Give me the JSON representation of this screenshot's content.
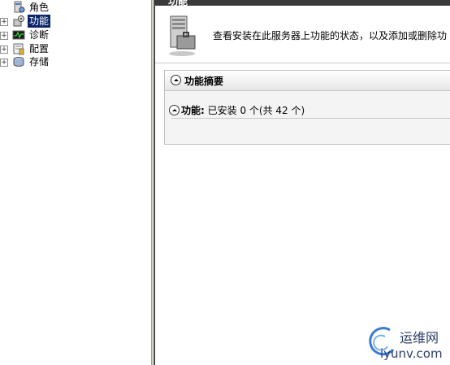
{
  "tree": {
    "items": [
      {
        "label": "角色",
        "expander": "",
        "icon": "roles-icon"
      },
      {
        "label": "功能",
        "expander": "+",
        "icon": "features-icon",
        "selected": true
      },
      {
        "label": "诊断",
        "expander": "+",
        "icon": "diagnostics-icon"
      },
      {
        "label": "配置",
        "expander": "+",
        "icon": "configuration-icon"
      },
      {
        "label": "存储",
        "expander": "+",
        "icon": "storage-icon"
      }
    ]
  },
  "content": {
    "title": "功能",
    "description": "查看安装在此服务器上功能的状态，以及添加或删除功",
    "panel": {
      "title": "功能摘要",
      "summary_label": "功能:",
      "summary_value": " 已安装 0 个(共 42 个)"
    }
  },
  "watermark": {
    "chinese": "运维网",
    "site": "iyunv.com"
  },
  "colors": {
    "selection": "#0a246a",
    "title_bar": "#3a3a3a",
    "panel_bg": "#f4f4f4"
  }
}
